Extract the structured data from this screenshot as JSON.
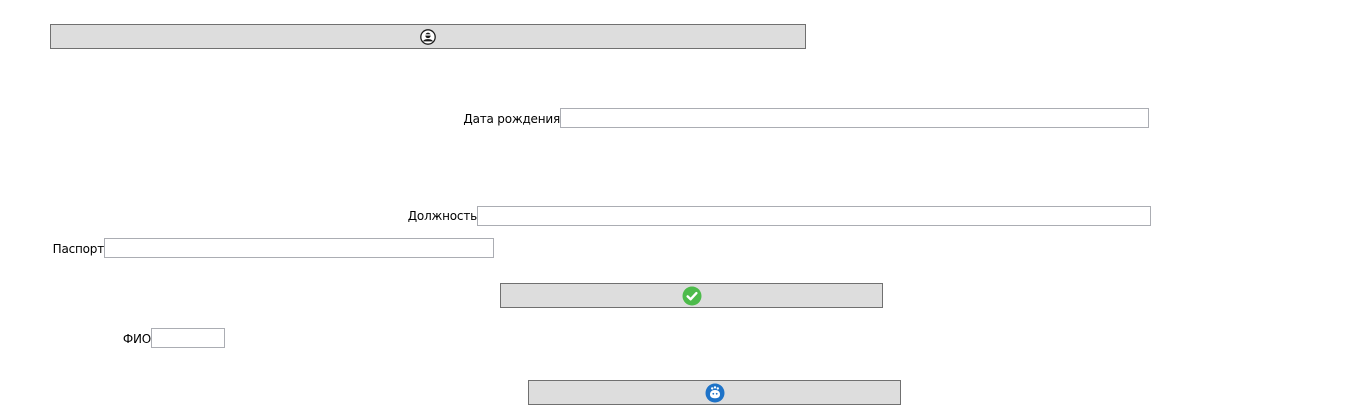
{
  "form": {
    "fields": [
      {
        "id": "birth-date",
        "label": "Дата рождения",
        "value": ""
      },
      {
        "id": "position",
        "label": "Должность",
        "value": ""
      },
      {
        "id": "passport",
        "label": "Паспорт",
        "value": ""
      },
      {
        "id": "full-name",
        "label": "ФИО",
        "value": ""
      }
    ]
  },
  "buttons": {
    "top": {
      "icon": "avatar-icon"
    },
    "confirm": {
      "icon": "checkmark-icon",
      "color": "#4dbb4b"
    },
    "bottom": {
      "icon": "blue-badge-icon",
      "color": "#1e73c8"
    }
  },
  "colors": {
    "button_bg": "#dddddd",
    "button_border": "#707070",
    "field_border": "#abadb3"
  }
}
